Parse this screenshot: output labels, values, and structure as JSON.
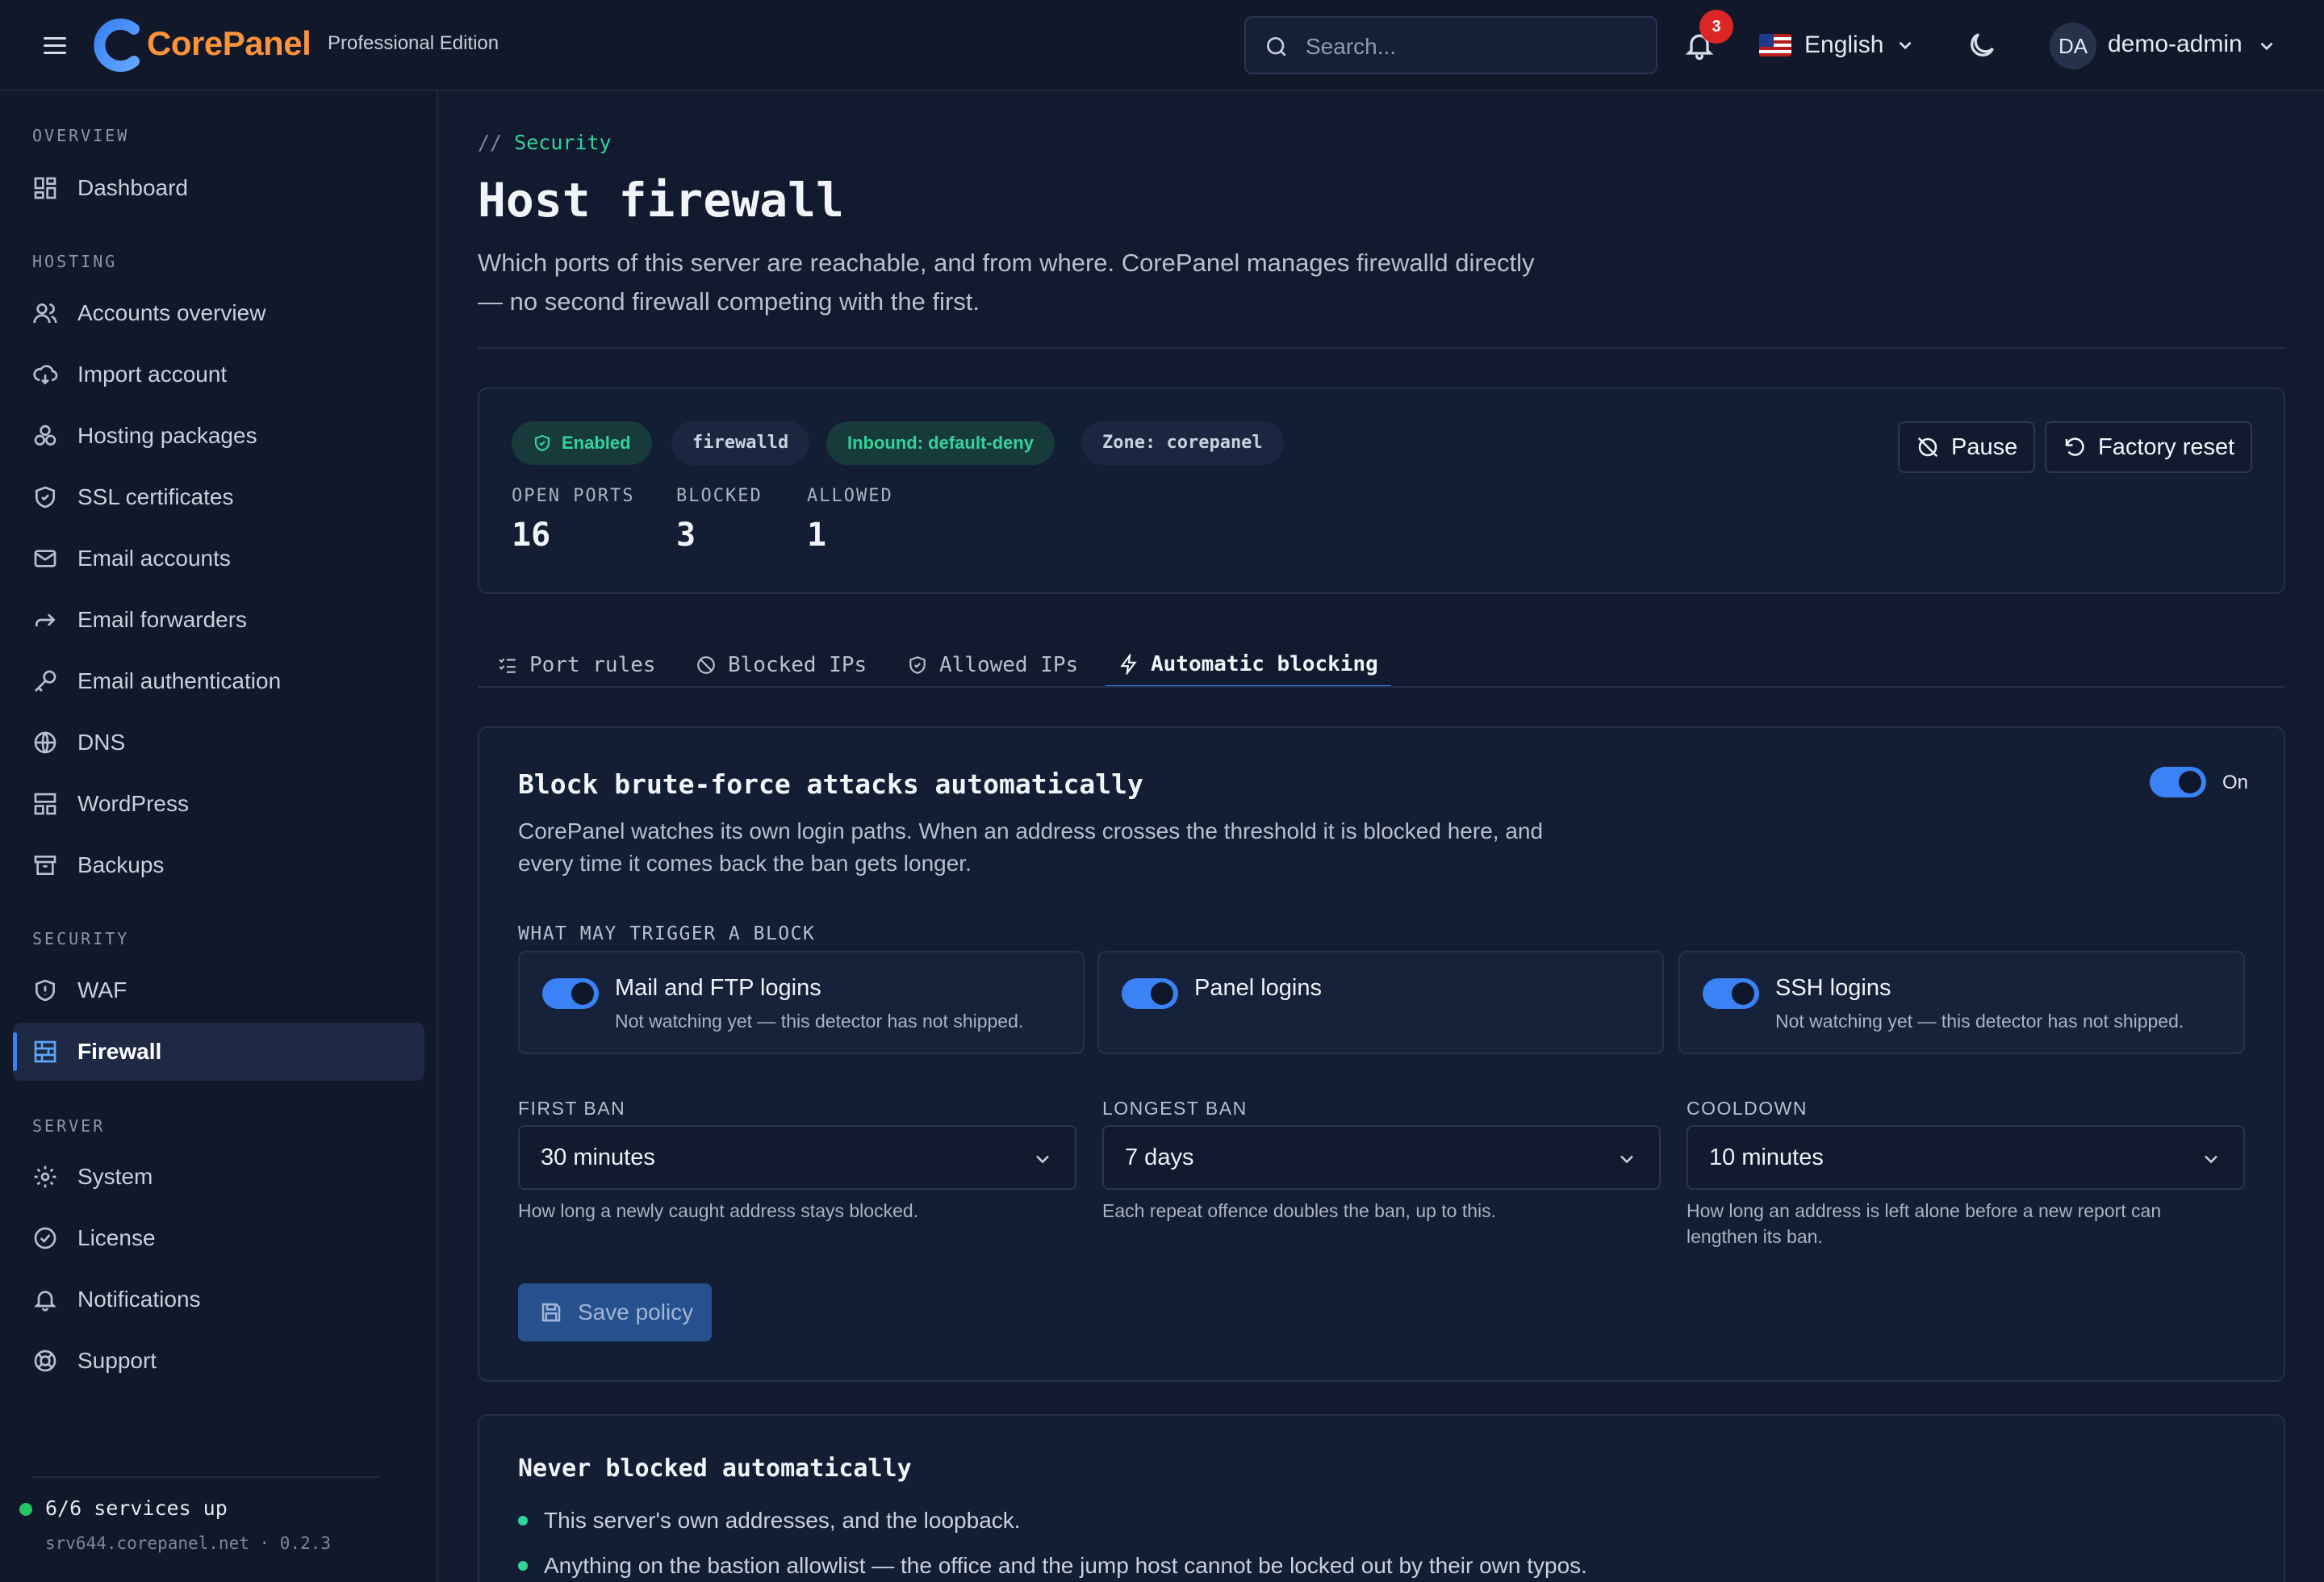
{
  "header": {
    "brand": "CorePanel",
    "edition": "Professional Edition",
    "search_placeholder": "Search...",
    "notification_count": "3",
    "language": "English",
    "avatar_initials": "DA",
    "username": "demo-admin"
  },
  "sidebar": {
    "sections": [
      {
        "title": "OVERVIEW",
        "items": [
          {
            "label": "Dashboard",
            "icon": "dashboard-icon"
          }
        ]
      },
      {
        "title": "HOSTING",
        "items": [
          {
            "label": "Accounts overview",
            "icon": "users-icon"
          },
          {
            "label": "Import account",
            "icon": "cloud-download-icon"
          },
          {
            "label": "Hosting packages",
            "icon": "packages-icon"
          },
          {
            "label": "SSL certificates",
            "icon": "shield-icon"
          },
          {
            "label": "Email accounts",
            "icon": "mail-icon"
          },
          {
            "label": "Email forwarders",
            "icon": "forward-icon"
          },
          {
            "label": "Email authentication",
            "icon": "key-icon"
          },
          {
            "label": "DNS",
            "icon": "globe-icon"
          },
          {
            "label": "WordPress",
            "icon": "layout-icon"
          },
          {
            "label": "Backups",
            "icon": "archive-icon"
          }
        ]
      },
      {
        "title": "SECURITY",
        "items": [
          {
            "label": "WAF",
            "icon": "shield-alert-icon"
          },
          {
            "label": "Firewall",
            "icon": "firewall-icon",
            "active": true
          }
        ]
      },
      {
        "title": "SERVER",
        "items": [
          {
            "label": "System",
            "icon": "gear-icon"
          },
          {
            "label": "License",
            "icon": "badge-check-icon"
          },
          {
            "label": "Notifications",
            "icon": "bell-icon"
          },
          {
            "label": "Support",
            "icon": "life-buoy-icon"
          }
        ]
      }
    ],
    "footer": {
      "status": "6/6 services up",
      "host": "srv644.corepanel.net · 0.2.3"
    }
  },
  "page": {
    "breadcrumb_prefix": "//",
    "breadcrumb": "Security",
    "title": "Host firewall",
    "description": "Which ports of this server are reachable, and from where. CorePanel manages firewalld directly — no second firewall competing with the first."
  },
  "status_card": {
    "pills": [
      "Enabled",
      "firewalld",
      "Inbound: default-deny",
      "Zone: corepanel"
    ],
    "stats": [
      {
        "label": "OPEN PORTS",
        "value": "16"
      },
      {
        "label": "BLOCKED",
        "value": "3"
      },
      {
        "label": "ALLOWED",
        "value": "1"
      }
    ],
    "pause_label": "Pause",
    "factory_reset_label": "Factory reset"
  },
  "tabs": [
    {
      "label": "Port rules",
      "icon": "list-checks-icon"
    },
    {
      "label": "Blocked IPs",
      "icon": "ban-icon"
    },
    {
      "label": "Allowed IPs",
      "icon": "shield-check-icon"
    },
    {
      "label": "Automatic blocking",
      "icon": "zap-icon",
      "active": true
    }
  ],
  "auto_block": {
    "title": "Block brute-force attacks automatically",
    "description": "CorePanel watches its own login paths. When an address crosses the threshold it is blocked here, and every time it comes back the ban gets longer.",
    "enabled_label": "On",
    "triggers_label": "WHAT MAY TRIGGER A BLOCK",
    "triggers": [
      {
        "title": "Mail and FTP logins",
        "subtitle": "Not watching yet — this detector has not shipped."
      },
      {
        "title": "Panel logins",
        "subtitle": ""
      },
      {
        "title": "SSH logins",
        "subtitle": "Not watching yet — this detector has not shipped."
      }
    ],
    "fields": [
      {
        "label": "FIRST BAN",
        "value": "30 minutes",
        "hint": "How long a newly caught address stays blocked."
      },
      {
        "label": "LONGEST BAN",
        "value": "7 days",
        "hint": "Each repeat offence doubles the ban, up to this."
      },
      {
        "label": "COOLDOWN",
        "value": "10 minutes",
        "hint": "How long an address is left alone before a new report can lengthen its ban."
      }
    ],
    "save_label": "Save policy"
  },
  "never_blocked": {
    "title": "Never blocked automatically",
    "items": [
      "This server's own addresses, and the loopback.",
      "Anything on the bastion allowlist — the office and the jump host cannot be locked out by their own typos."
    ]
  },
  "colors": {
    "accent": "#3b82f6",
    "brand": "#fb923c",
    "success": "#34d399",
    "danger": "#dc2626"
  }
}
